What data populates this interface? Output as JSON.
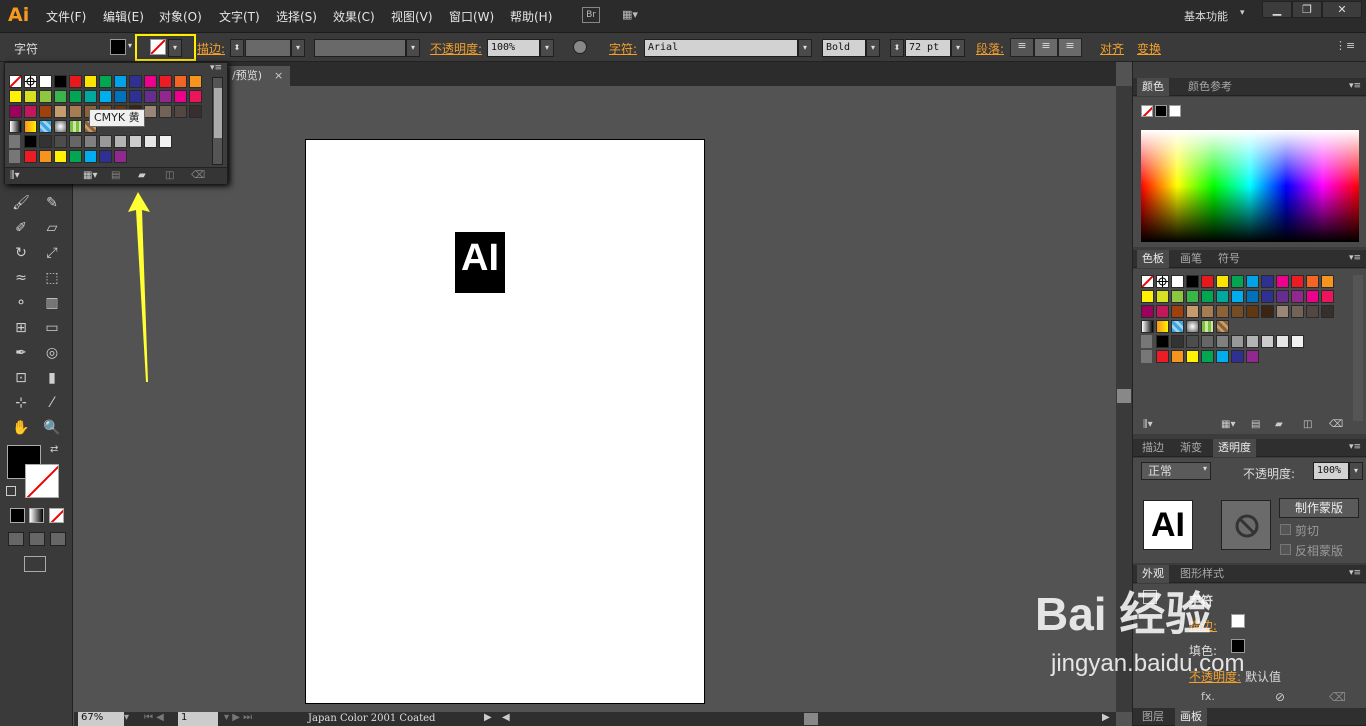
{
  "app": {
    "logo": "Ai"
  },
  "menu": [
    "文件(F)",
    "编辑(E)",
    "对象(O)",
    "文字(T)",
    "选择(S)",
    "效果(C)",
    "视图(V)",
    "窗口(W)",
    "帮助(H)"
  ],
  "bridge": "Br",
  "workspace": "基本功能",
  "control": {
    "char_label": "字符",
    "stroke_label": "描边:",
    "opacity_label": "不透明度:",
    "opacity_value": "100%",
    "font_label": "字符:",
    "font_value": "Arial",
    "weight_value": "Bold",
    "size_value": "72 pt",
    "para_label": "段落:",
    "align_label": "对齐",
    "transform_label": "变换"
  },
  "document": {
    "tab_label": "/预览)",
    "close": "×"
  },
  "swatch_popup": {
    "tooltip": "CMYK 黄"
  },
  "artboard": {
    "logo_text": "AI"
  },
  "status": {
    "zoom": "67%",
    "page": "1",
    "profile": "Japan Color 2001 Coated"
  },
  "panels": {
    "color_tabs": [
      "颜色",
      "颜色参考"
    ],
    "swatch_tabs": [
      "色板",
      "画笔",
      "符号"
    ],
    "transparency_tabs": [
      "描边",
      "渐变",
      "透明度"
    ],
    "blend_mode": "正常",
    "opacity_label": "不透明度:",
    "opacity_value": "100%",
    "make_mask": "制作蒙版",
    "clip": "剪切",
    "invert": "反相蒙版",
    "thumb_text": "AI",
    "appearance_tabs": [
      "外观",
      "图形样式"
    ],
    "appearance_title": "字符",
    "ap_stroke": "描边:",
    "ap_fill": "填色:",
    "ap_opacity": "不透明度:",
    "ap_default": "默认值",
    "bottom_tabs": [
      "图层",
      "画板"
    ]
  },
  "watermark": {
    "brand": "Bai 经验",
    "url": "jingyan.baidu.com"
  }
}
